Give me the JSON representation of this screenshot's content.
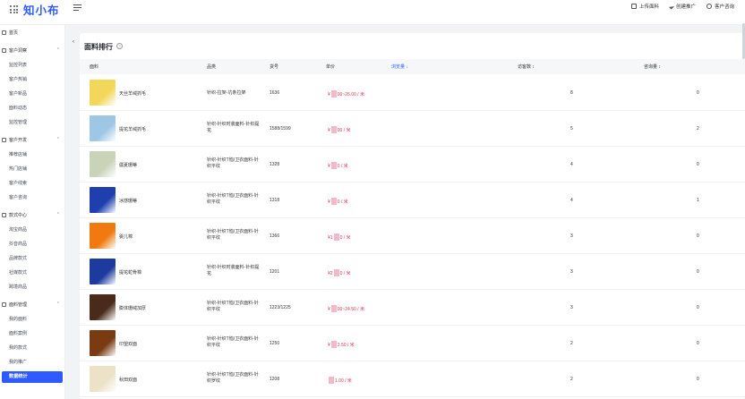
{
  "app": {
    "logo": "知小布"
  },
  "toolbar": {
    "upload": "上传面料",
    "create_promo": "创建推广",
    "consult": "客户咨询"
  },
  "sidebar": {
    "home": "首页",
    "groups": [
      {
        "label": "客户洞察",
        "items": [
          "监控列表",
          "客户热销",
          "客户新品",
          "面料动态",
          "监控管理"
        ]
      },
      {
        "label": "客户开发",
        "items": [
          "推荐店铺",
          "热门店铺",
          "客户线索",
          "客户咨询"
        ]
      },
      {
        "label": "款式中心",
        "items": [
          "淘宝商品",
          "抖音商品",
          "品牌款式",
          "社媒款式",
          "跨境商品"
        ]
      },
      {
        "label": "面料管理",
        "items": [
          "我的面料",
          "面料案例",
          "我的款式",
          "我的推广"
        ]
      }
    ],
    "active": "数据统计"
  },
  "panel": {
    "title": "面料排行",
    "help": "?"
  },
  "table": {
    "headers": {
      "fabric": "面料",
      "category": "品类",
      "item_no": "货号",
      "price": "单价",
      "views": "浏览量 ↓",
      "visitors": "访客数 ↕",
      "inquiries": "咨询量 ↕"
    },
    "rows": [
      {
        "name": "天丝羊绒抓毛",
        "cat": "针织-拉架-坑条拉架",
        "no": "1636",
        "price_a": "¥",
        "price_b": "00~26.00 / 米",
        "visitors": "8",
        "inquiries": "0",
        "color": "#f2d75a"
      },
      {
        "name": "提花羊绒抓毛",
        "cat": "针织-针织时装面料-针织提花",
        "no": "1588/1599",
        "price_a": "¥",
        "price_b": "00 / 米",
        "visitors": "5",
        "inquiries": "2",
        "color": "#9ec7e6"
      },
      {
        "name": "疆夏珊蒂",
        "cat": "针织-针织T恤/卫衣面料-针织平纹",
        "no": "1328",
        "price_a": "¥",
        "price_b": "0 / 米",
        "visitors": "4",
        "inquiries": "0",
        "color": "#c9d3b8"
      },
      {
        "name": "冰感珊蒂",
        "cat": "针织-针织T恤/卫衣面料-针织平纹",
        "no": "1318",
        "price_a": "¥",
        "price_b": "0 / 米",
        "visitors": "4",
        "inquiries": "1",
        "color": "#1f3fae"
      },
      {
        "name": "婴儿棉",
        "cat": "针织-针织T恤/卫衣面料-针织平纹",
        "no": "1366",
        "price_a": "¥1",
        "price_b": "0 / 米",
        "visitors": "3",
        "inquiries": "0",
        "color": "#f07a10"
      },
      {
        "name": "提花蛇骨棉",
        "cat": "针织-针织时装面料-针织提花",
        "no": "1201",
        "price_a": "¥2",
        "price_b": "0 / 米",
        "visitors": "3",
        "inquiries": "0",
        "color": "#1d3a9e"
      },
      {
        "name": "膨体珊绒加厚",
        "cat": "针织-针织T恤/卫衣面料-针织平纹",
        "no": "1223/1225",
        "price_a": "¥",
        "price_b": "00~24.50 / 米",
        "visitors": "3",
        "inquiries": "0",
        "color": "#4a2a1a"
      },
      {
        "name": "印望双面",
        "cat": "针织-针织T恤/卫衣面料-针织平纹",
        "no": "1250",
        "price_a": "¥",
        "price_b": "3.50 / 米",
        "visitors": "2",
        "inquiries": "0",
        "color": "#7a3a12"
      },
      {
        "name": "秋田双面",
        "cat": "针织-针织T恤/卫衣面料-针织罗纹",
        "no": "1208",
        "price_a": "",
        "price_b": "1.00 / 米",
        "visitors": "2",
        "inquiries": "0",
        "color": "#ece2c8"
      }
    ]
  }
}
